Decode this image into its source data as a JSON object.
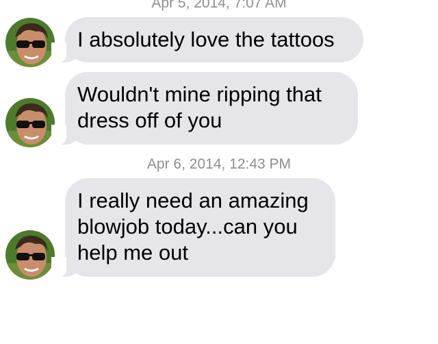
{
  "conversation": {
    "timestamps": [
      "Apr 5, 2014, 7:07 AM",
      "Apr 6, 2014, 12:43 PM"
    ],
    "messages": [
      {
        "text": "I absolutely love the tattoos"
      },
      {
        "text": "Wouldn't mine ripping that dress off of you"
      },
      {
        "text": "I really need an amazing blowjob today...can you help me out"
      }
    ]
  },
  "colors": {
    "bubble_background": "#e5e5ea",
    "timestamp_text": "#8e8e93",
    "message_text": "#000000",
    "page_background": "#ffffff"
  },
  "icons": {
    "avatar": "avatar-photo-sunglasses"
  }
}
